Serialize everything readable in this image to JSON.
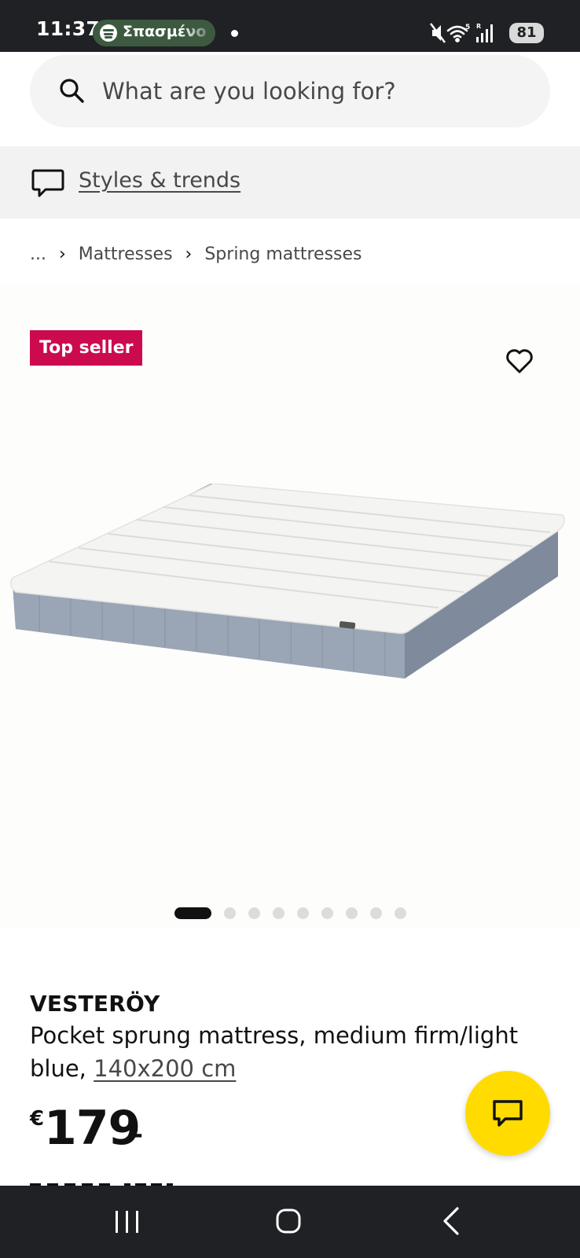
{
  "status_bar": {
    "time": "11:37",
    "media_pill": "Σπασμένο",
    "battery": "81"
  },
  "search": {
    "placeholder": "What are you looking for?"
  },
  "styles_link": "Styles & trends",
  "breadcrumb": {
    "ellipsis": "...",
    "items": [
      "Mattresses",
      "Spring mattresses"
    ]
  },
  "product": {
    "badge": "Top seller",
    "name": "VESTERÖY",
    "description": "Pocket sprung mattress, medium firm/light blue, ",
    "size": "140x200 cm",
    "price_currency": "€",
    "price_integer": "179",
    "price_decimal": ".-"
  },
  "carousel": {
    "count": 10,
    "active_index": 0
  },
  "colors": {
    "badge": "#cc0a4f",
    "fab": "#ffdb00",
    "system_bar": "#202124"
  }
}
